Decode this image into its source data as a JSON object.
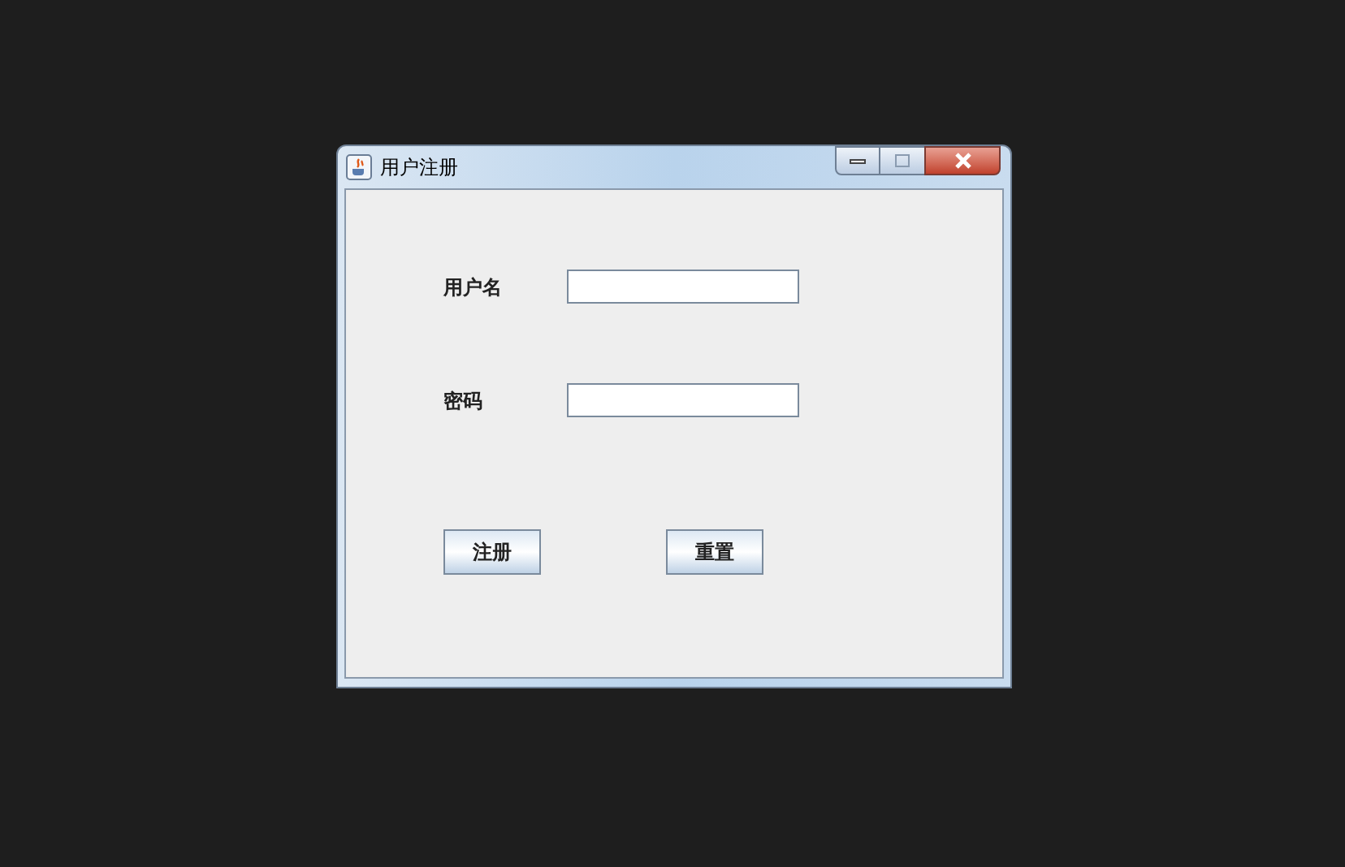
{
  "window": {
    "title": "用户注册"
  },
  "fields": [
    {
      "label": "用户名"
    },
    {
      "label": "密码"
    }
  ],
  "buttons": [
    "注册",
    "重置"
  ]
}
